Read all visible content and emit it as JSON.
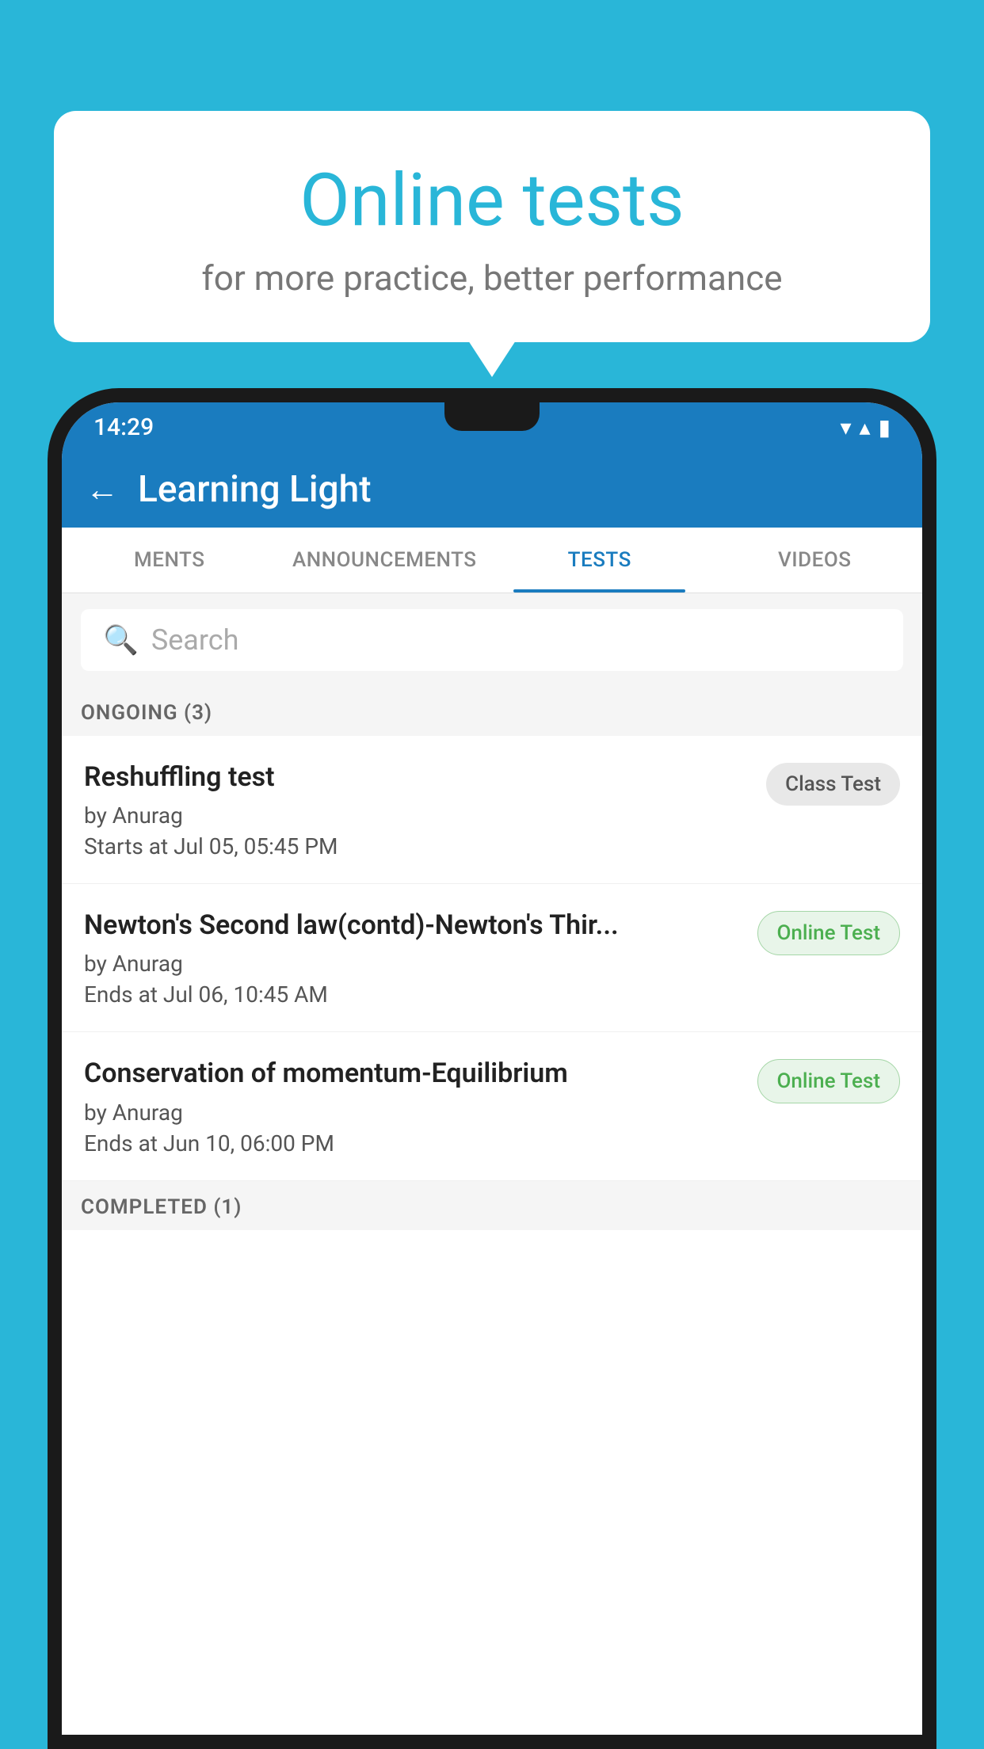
{
  "background": {
    "color": "#29b6d8"
  },
  "speech_bubble": {
    "title": "Online tests",
    "subtitle": "for more practice, better performance"
  },
  "phone": {
    "status_bar": {
      "time": "14:29",
      "wifi": "▼",
      "signal": "▲",
      "battery": "▮"
    },
    "header": {
      "back_label": "←",
      "title": "Learning Light"
    },
    "tabs": [
      {
        "label": "MENTS",
        "active": false
      },
      {
        "label": "ANNOUNCEMENTS",
        "active": false
      },
      {
        "label": "TESTS",
        "active": true
      },
      {
        "label": "VIDEOS",
        "active": false
      }
    ],
    "search": {
      "placeholder": "Search"
    },
    "ongoing_section": {
      "title": "ONGOING (3)"
    },
    "tests": [
      {
        "name": "Reshuffling test",
        "by": "by Anurag",
        "date": "Starts at  Jul 05, 05:45 PM",
        "badge": "Class Test",
        "badge_type": "class"
      },
      {
        "name": "Newton's Second law(contd)-Newton's Thir...",
        "by": "by Anurag",
        "date": "Ends at  Jul 06, 10:45 AM",
        "badge": "Online Test",
        "badge_type": "online"
      },
      {
        "name": "Conservation of momentum-Equilibrium",
        "by": "by Anurag",
        "date": "Ends at  Jun 10, 06:00 PM",
        "badge": "Online Test",
        "badge_type": "online"
      }
    ],
    "completed_section": {
      "title": "COMPLETED (1)"
    }
  }
}
